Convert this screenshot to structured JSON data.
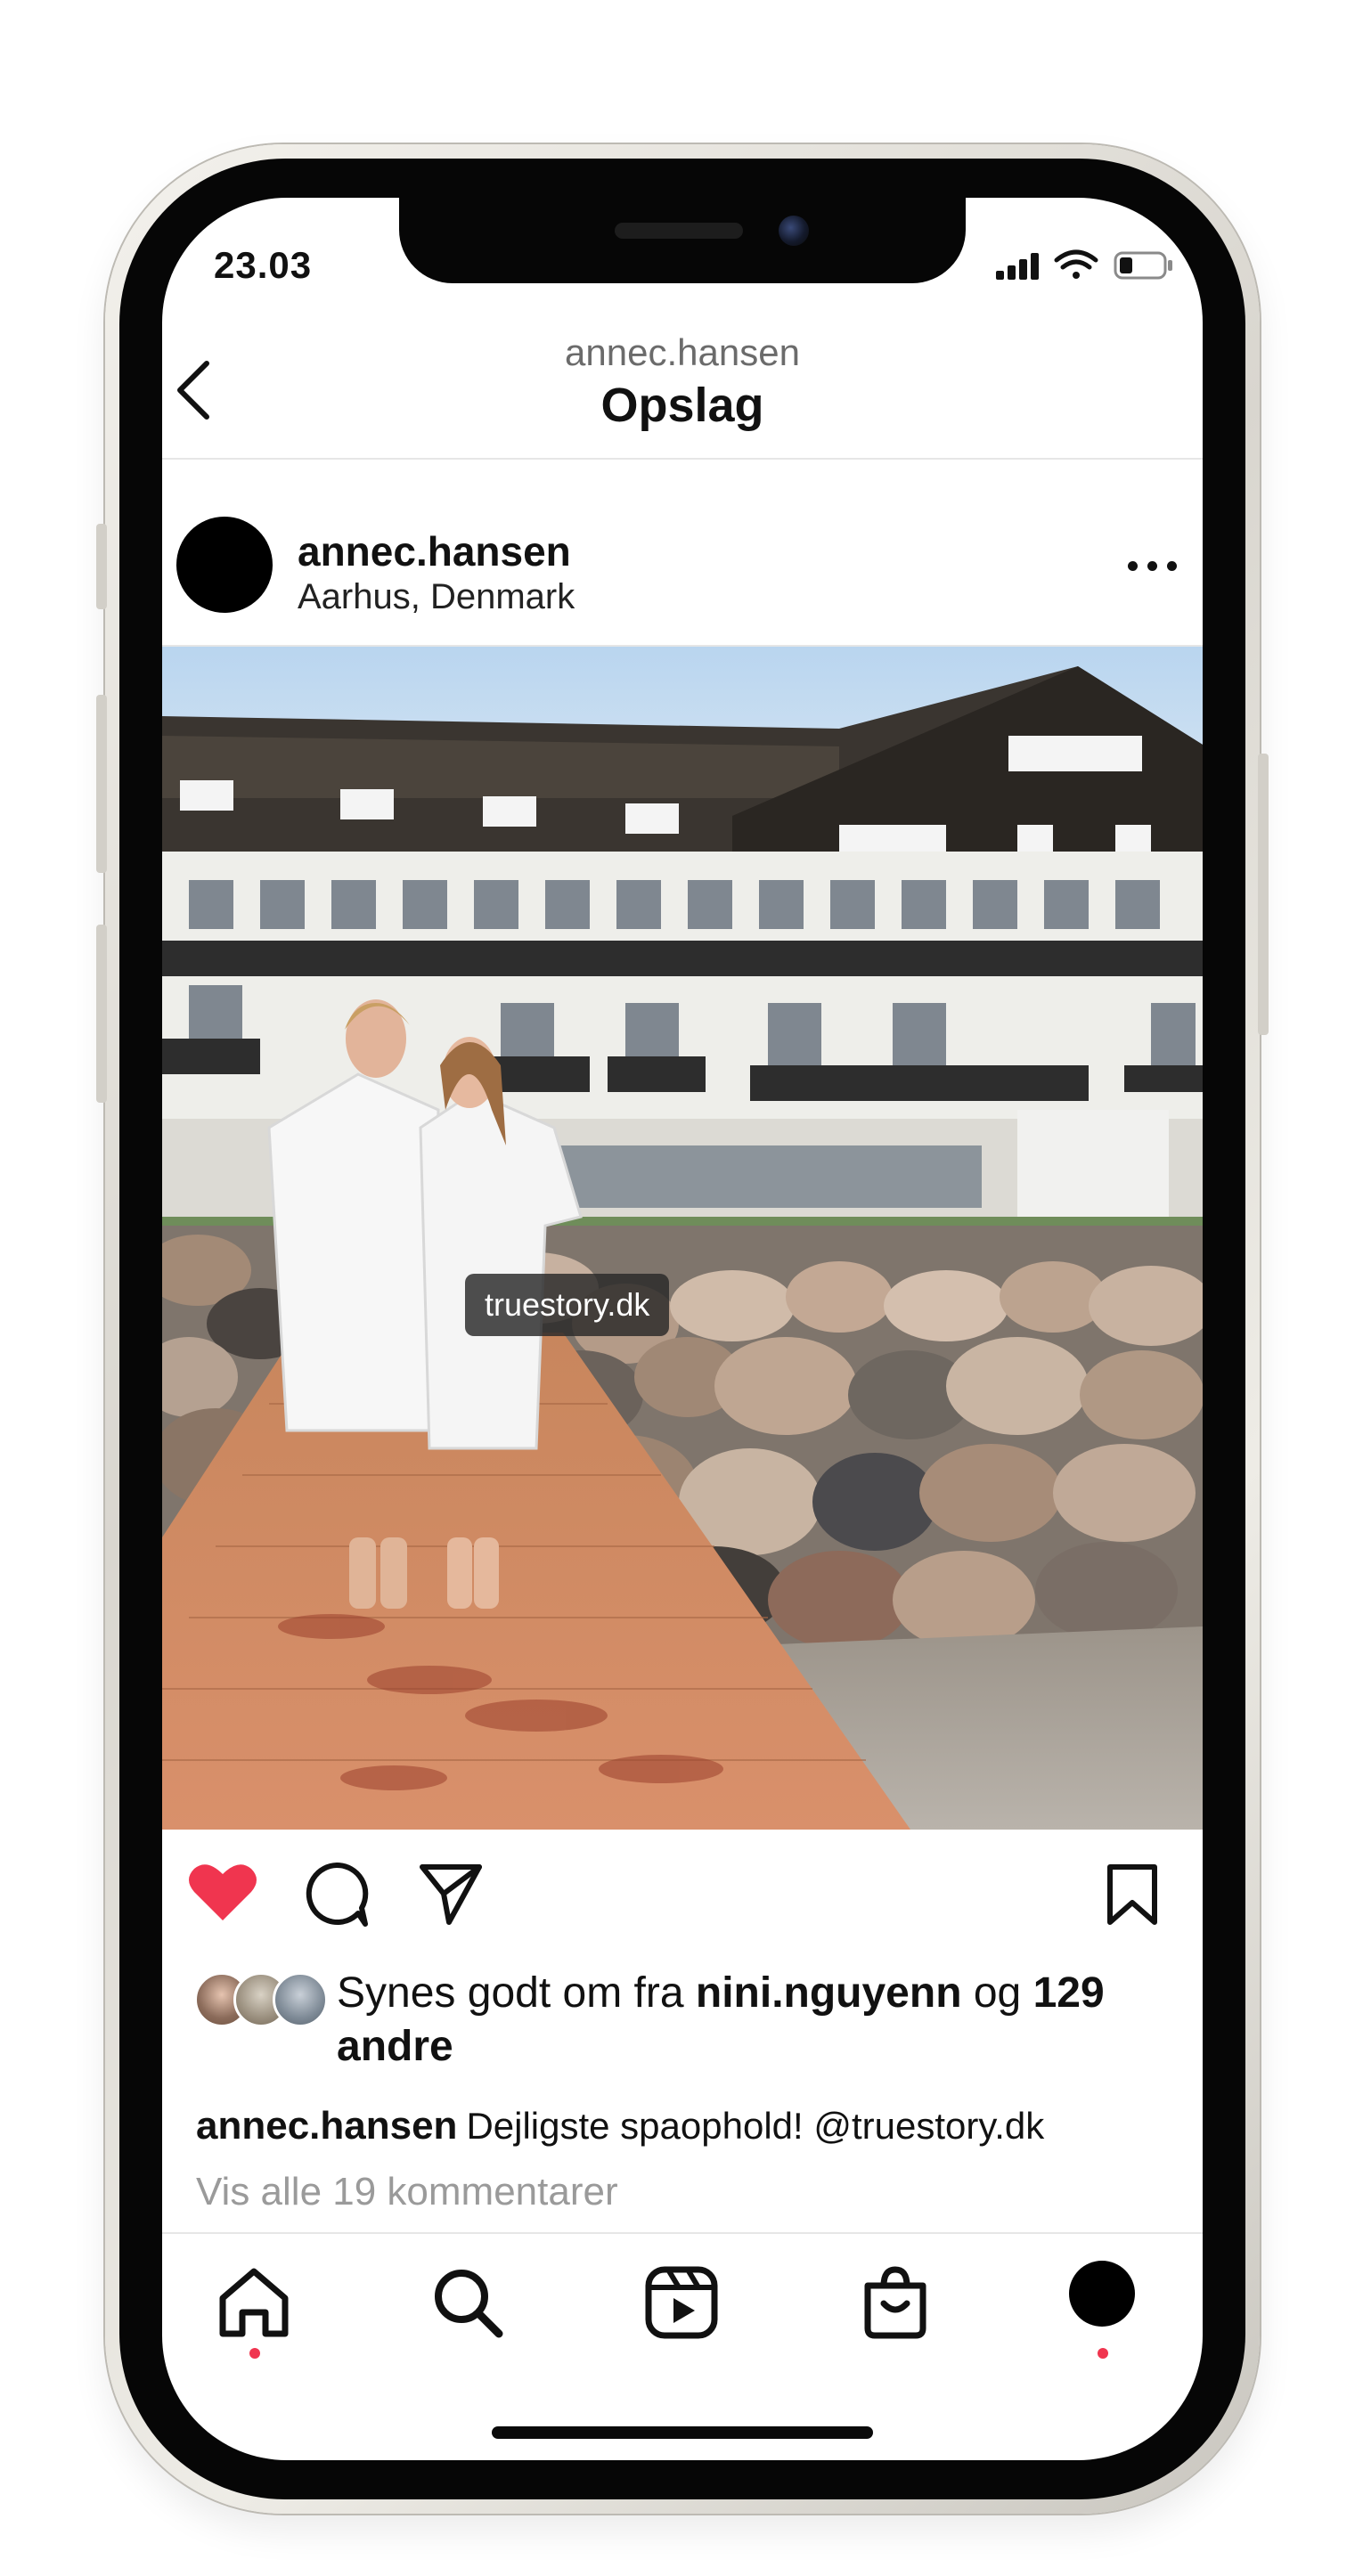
{
  "status_bar": {
    "time": "23.03"
  },
  "header": {
    "subtitle": "annec.hansen",
    "title": "Opslag"
  },
  "post": {
    "username": "annec.hansen",
    "location": "Aarhus, Denmark",
    "tag": "truestory.dk",
    "liked": true,
    "likes": {
      "prefix": "Synes godt om fra ",
      "user": "nini.nguyenn",
      "middle": " og ",
      "count_text": "129 andre"
    },
    "caption": {
      "username": "annec.hansen",
      "text": "Dejligste spaophold! @truestory.dk"
    },
    "comments_link": "Vis alle 19 kommentarer"
  },
  "icons": {
    "back": "chevron-left-icon",
    "more": "more-horizontal-icon",
    "like": "heart-icon",
    "comment": "comment-icon",
    "share": "send-icon",
    "save": "bookmark-icon",
    "nav": [
      "home-icon",
      "search-icon",
      "reels-icon",
      "shop-icon",
      "profile-avatar"
    ]
  },
  "colors": {
    "like_red": "#f0354f",
    "muted_text": "#9a9a9a",
    "accent_dot": "#f0354f"
  }
}
